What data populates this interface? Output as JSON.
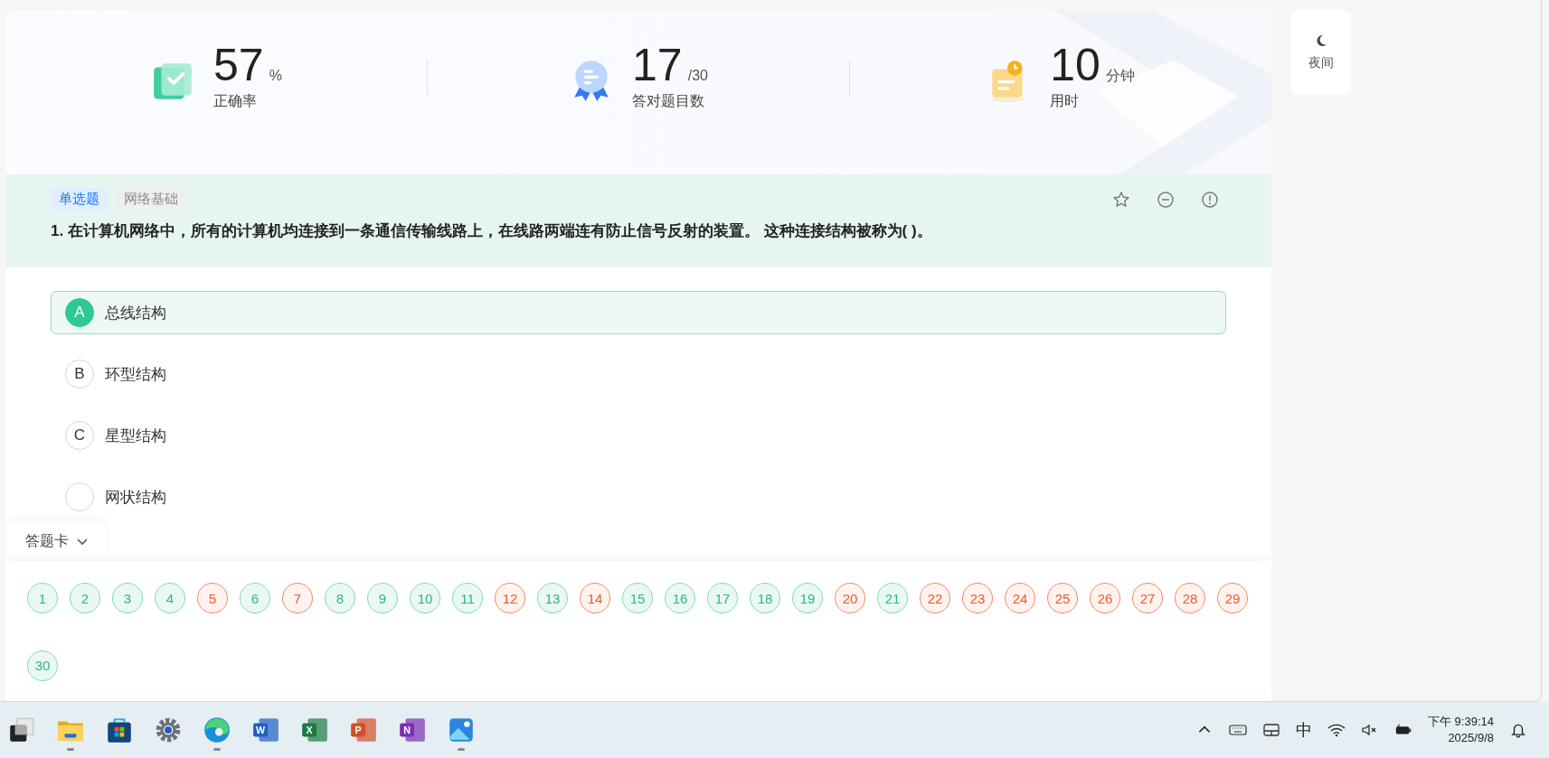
{
  "stats": [
    {
      "kind": "accuracy",
      "value": "57",
      "unit": "%",
      "label": "正确率"
    },
    {
      "kind": "count",
      "value": "17",
      "unit": "/30",
      "label": "答对题目数"
    },
    {
      "kind": "time",
      "value": "10",
      "unit": "分钟",
      "label": "用时"
    }
  ],
  "night_button": {
    "label": "夜间"
  },
  "question": {
    "tags": [
      {
        "kind": "type",
        "label": "单选题"
      },
      {
        "kind": "topic",
        "label": "网络基础"
      }
    ],
    "text": "1. 在计算机网络中，所有的计算机均连接到一条通信传输线路上，在线路两端连有防止信号反射的装置。 这种连接结构被称为(    )。"
  },
  "options": [
    {
      "letter": "A",
      "text": "总线结构",
      "selected": true
    },
    {
      "letter": "B",
      "text": "环型结构",
      "selected": false
    },
    {
      "letter": "C",
      "text": "星型结构",
      "selected": false
    },
    {
      "text": "网状结构",
      "selected": false
    }
  ],
  "answer_card": {
    "title": "答题卡",
    "expanded": true,
    "items": [
      {
        "number": "1",
        "correct": true
      },
      {
        "number": "2",
        "correct": true
      },
      {
        "number": "3",
        "correct": true
      },
      {
        "number": "4",
        "correct": true
      },
      {
        "number": "5",
        "correct": false
      },
      {
        "number": "6",
        "correct": true
      },
      {
        "number": "7",
        "correct": false
      },
      {
        "number": "8",
        "correct": true
      },
      {
        "number": "9",
        "correct": true
      },
      {
        "number": "10",
        "correct": true
      },
      {
        "number": "11",
        "correct": true
      },
      {
        "number": "12",
        "correct": false
      },
      {
        "number": "13",
        "correct": true
      },
      {
        "number": "14",
        "correct": false
      },
      {
        "number": "15",
        "correct": true
      },
      {
        "number": "16",
        "correct": true
      },
      {
        "number": "17",
        "correct": true
      },
      {
        "number": "18",
        "correct": true
      },
      {
        "number": "19",
        "correct": true
      },
      {
        "number": "20",
        "correct": false
      },
      {
        "number": "21",
        "correct": true
      },
      {
        "number": "22",
        "correct": false
      },
      {
        "number": "23",
        "correct": false
      },
      {
        "number": "24",
        "correct": false
      },
      {
        "number": "25",
        "correct": false
      },
      {
        "number": "26",
        "correct": false
      },
      {
        "number": "27",
        "correct": false
      },
      {
        "number": "28",
        "correct": false
      },
      {
        "number": "29",
        "correct": false
      },
      {
        "number": "30",
        "correct": true
      }
    ]
  },
  "taskbar": {
    "apps": [
      {
        "kind": "task-view",
        "running": false
      },
      {
        "kind": "folder",
        "running": true
      },
      {
        "kind": "store",
        "running": false
      },
      {
        "kind": "settings",
        "running": false
      },
      {
        "kind": "browser",
        "running": true
      },
      {
        "kind": "word",
        "letter": "W",
        "running": false
      },
      {
        "kind": "excel",
        "letter": "X",
        "running": false
      },
      {
        "kind": "powerpoint",
        "letter": "P",
        "running": false
      },
      {
        "kind": "onenote",
        "letter": "N",
        "running": false
      },
      {
        "kind": "photos",
        "running": true
      }
    ],
    "input_method": "中",
    "time": "下午 9:39:14",
    "date": "2025/9/8"
  }
}
